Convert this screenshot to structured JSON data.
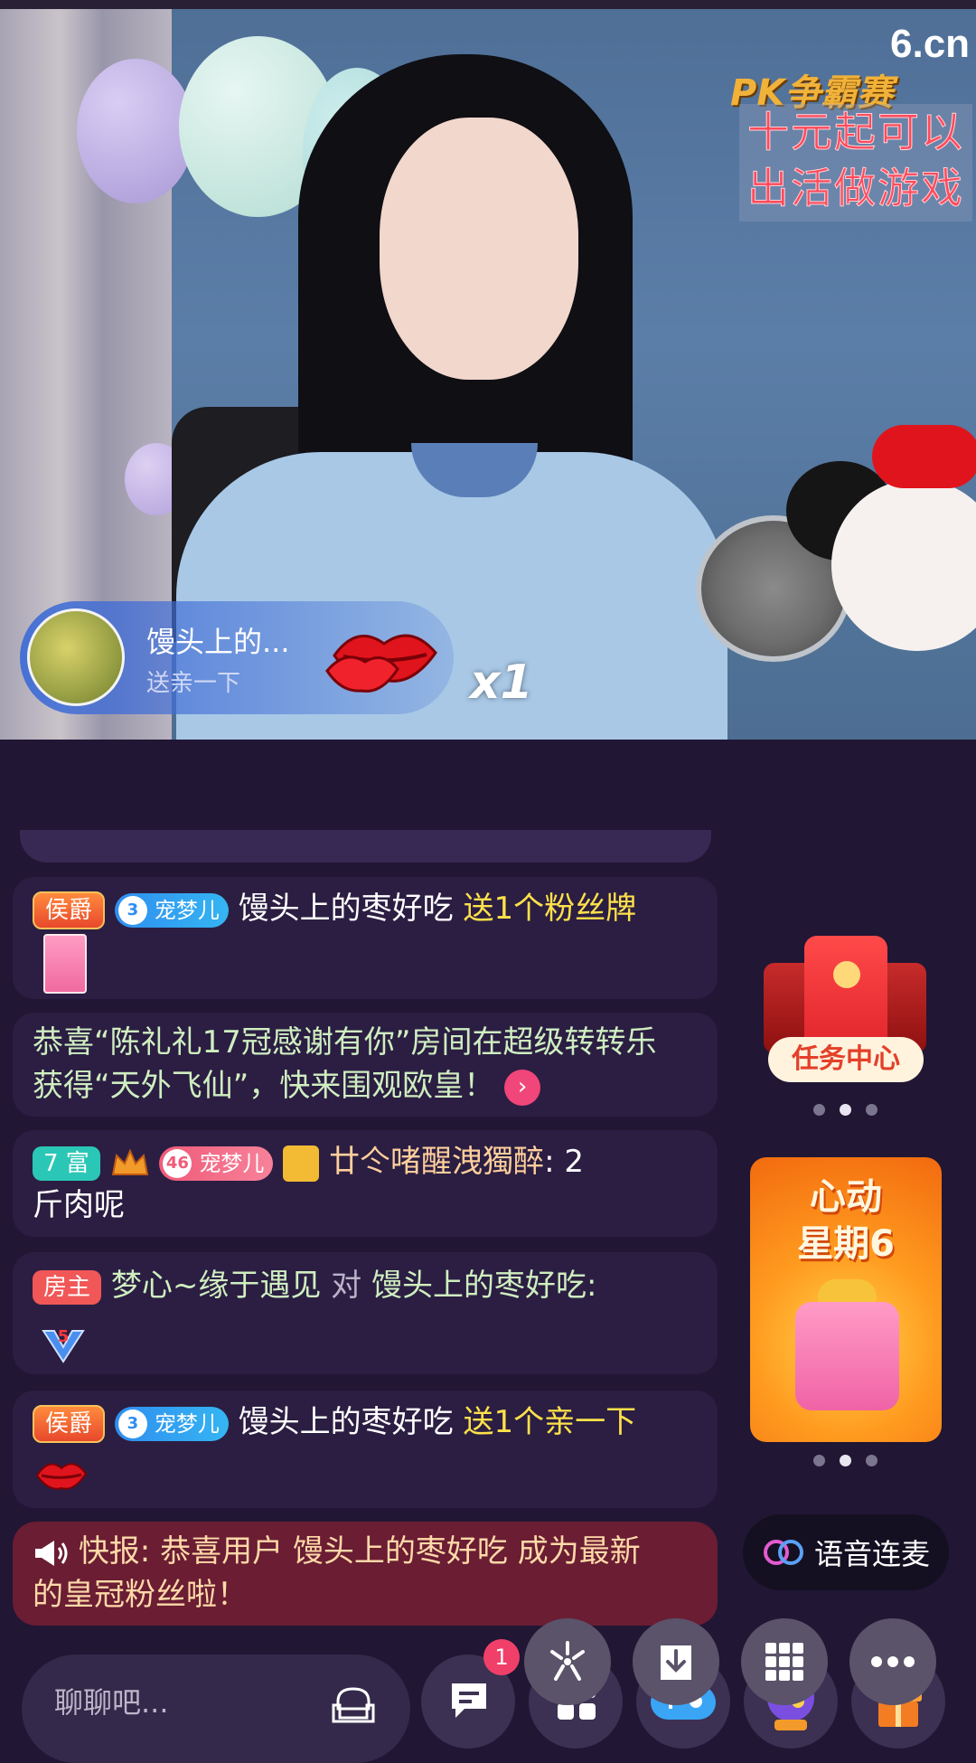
{
  "video": {
    "watermark": "6.cn",
    "pk_title": "PK争霸赛",
    "promo_lines": [
      "十元起可以",
      "出活做游戏"
    ],
    "gift_toast": {
      "user": "馒头上的...",
      "action": "送亲一下",
      "count": "x1"
    }
  },
  "chat": {
    "messages": [
      {
        "title_badge": "侯爵",
        "fan_level": "3",
        "fan_badge": "宠梦儿",
        "user": "馒头上的枣好吃",
        "action": "送1个粉丝牌"
      },
      {
        "line1": "恭喜“陈礼礼17冠感谢有你”房间在超级转转乐",
        "line2": "获得“天外飞仙”，快来围观欧皇！",
        "arrow": "›"
      },
      {
        "rich_badge": "7 富",
        "fan_level": "46",
        "fan_badge": "宠梦儿",
        "user": "廿仒啫醒洩獨醉",
        "content_tail": ": 2",
        "content_line2": "斤肉呢"
      },
      {
        "role_badge": "房主",
        "user": "梦心~缘于遇见",
        "to_word": "对",
        "target": "馒头上的枣好吃:",
        "level_value": "5"
      },
      {
        "title_badge": "侯爵",
        "fan_level": "3",
        "fan_badge": "宠梦儿",
        "user": "馒头上的枣好吃",
        "action": "送1个亲一下"
      }
    ],
    "news": {
      "line1": "快报: 恭喜用户 馒头上的枣好吃 成为最新",
      "line2": "的皇冠粉丝啦！"
    }
  },
  "side": {
    "task_center_label": "任务中心",
    "banner_lines": [
      "心动",
      "星期6"
    ],
    "voice_label": "语音连麦"
  },
  "bottom": {
    "input_placeholder": "聊聊吧...",
    "notification_count": "1"
  }
}
